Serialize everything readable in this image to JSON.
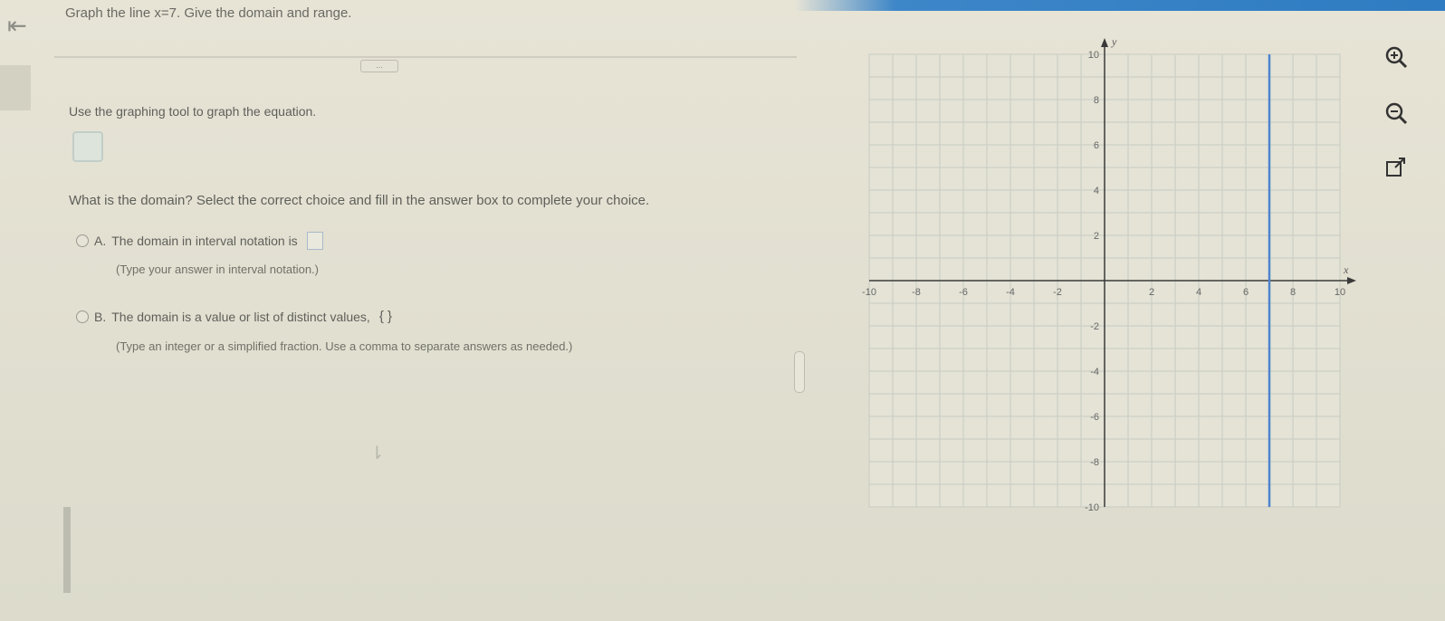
{
  "problem": {
    "text": "Graph the line x=7. Give the domain and range."
  },
  "instructions": "Use the graphing tool to graph the equation.",
  "more_label": "...",
  "question": "What is the domain? Select the correct choice and fill in the answer box to complete your choice.",
  "choices": [
    {
      "letter": "A.",
      "text": "The domain in interval notation is",
      "hint": "(Type your answer in interval notation.)"
    },
    {
      "letter": "B.",
      "text": "The domain is a value or list of distinct values,",
      "braces": "{ }",
      "hint": "(Type an integer or a simplified fraction. Use a comma to separate answers as needed.)"
    }
  ],
  "graph": {
    "x_label": "x",
    "y_label": "y",
    "x_ticks": [
      -10,
      -8,
      -6,
      -4,
      -2,
      2,
      4,
      6,
      8,
      10
    ],
    "y_ticks": [
      -10,
      -8,
      -6,
      -4,
      -2,
      2,
      4,
      6,
      8,
      10
    ],
    "range": [
      -10,
      10
    ],
    "vertical_line_x": 7,
    "line_color": "#4f83cc",
    "grid_color": "#c9cbc3",
    "axis_color": "#3a3a3a"
  },
  "tools": {
    "zoom_in": "zoom-in-icon",
    "zoom_out": "zoom-out-icon",
    "popout": "popout-icon"
  },
  "back_icon": "back-arrow-icon"
}
